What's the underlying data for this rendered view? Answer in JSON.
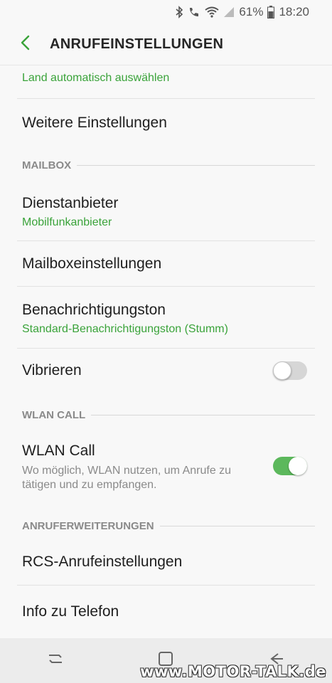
{
  "status": {
    "battery": "61%",
    "time": "18:20"
  },
  "header": {
    "title": "ANRUFEINSTELLUNGEN"
  },
  "rows": {
    "network_partial_sub": "Land automatisch auswählen",
    "more_settings": "Weitere Einstellungen",
    "provider_title": "Dienstanbieter",
    "provider_sub": "Mobilfunkanbieter",
    "mailbox_settings": "Mailboxeinstellungen",
    "notif_title": "Benachrichtigungston",
    "notif_sub": "Standard-Benachrichtigungston (Stumm)",
    "vibrate": "Vibrieren",
    "wlan_title": "WLAN Call",
    "wlan_desc": "Wo möglich, WLAN nutzen, um Anrufe zu tätigen und zu empfangen.",
    "rcs": "RCS-Anrufeinstellungen",
    "info": "Info zu Telefon"
  },
  "sections": {
    "mailbox": "MAILBOX",
    "wlan": "WLAN CALL",
    "extensions": "ANRUFERWEITERUNGEN"
  },
  "toggles": {
    "vibrate_on": false,
    "wlan_on": true
  },
  "colors": {
    "accent": "#3aa33a",
    "toggle_on": "#5cb85c"
  },
  "watermark": "www.MOTOR-TALK.de"
}
